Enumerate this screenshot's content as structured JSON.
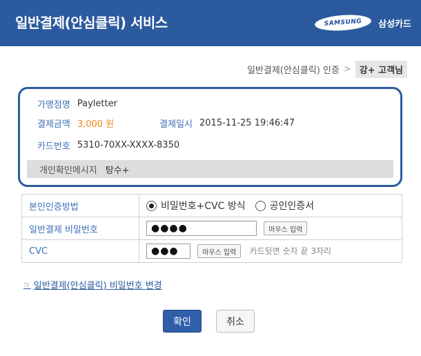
{
  "header": {
    "title": "일반결제(안심클릭) 서비스",
    "samsung_logo": "SAMSUNG",
    "card_brand": "삼성카드"
  },
  "breadcrumb": {
    "step": "일반결제(안심클릭) 인증",
    "separator": ">",
    "user": "강+ 고객님"
  },
  "merchant": {
    "name_label": "가맹점명",
    "name_value": "Payletter",
    "amount_label": "결제금액",
    "amount_value": "3,000 원",
    "date_label": "결제일시",
    "date_value": "2015-11-25 19:46:47",
    "card_label": "카드번호",
    "card_value": "5310-70XX-XXXX-8350",
    "message_label": "개인확인메시지",
    "message_value": "탕수+"
  },
  "auth": {
    "method_label": "본인인증방법",
    "option_pw_cvc": "비밀번호+CVC 방식",
    "option_cert": "공인인증서",
    "password_label": "일반결제 비밀번호",
    "password_value": "●●●●",
    "mouse_input_label": "마우스 입력",
    "cvc_label": "CVC",
    "cvc_value": "●●●",
    "cvc_hint": "카드뒷면 숫자 끝 3자리"
  },
  "change_password_link": "일반결제(안심클릭) 비밀번호 변경",
  "buttons": {
    "confirm": "확인",
    "cancel": "취소"
  },
  "colors": {
    "header_bg": "#2b5a9e",
    "accent_orange": "#f08a1e"
  }
}
